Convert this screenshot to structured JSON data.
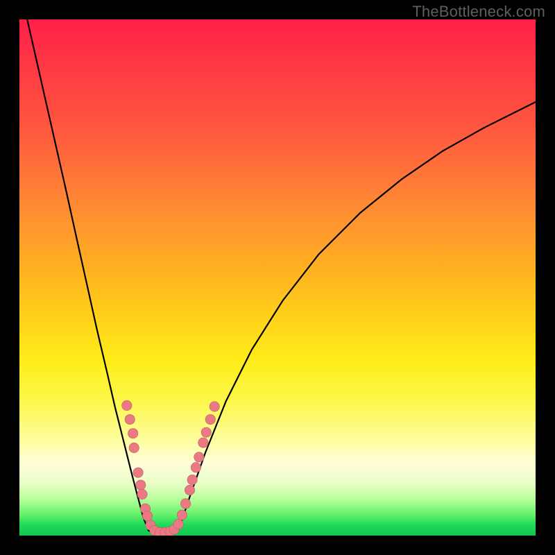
{
  "watermark": "TheBottleneck.com",
  "colors": {
    "frame": "#000000",
    "curve": "#000000",
    "bead_fill": "#e97a84",
    "bead_stroke": "#c25b66",
    "gradient_stops": [
      "#ff1f47",
      "#ff5a3e",
      "#ffb022",
      "#ffec1a",
      "#fefed8",
      "#63f06a",
      "#12c74f"
    ]
  },
  "chart_data": {
    "type": "line",
    "title": "",
    "xlabel": "",
    "ylabel": "",
    "xlim": [
      0,
      1
    ],
    "ylim": [
      0,
      1
    ],
    "note": "No tick labels visible; coordinates are normalized 0-1 with origin at bottom-left of the gradient panel.",
    "series": [
      {
        "name": "left-branch",
        "x": [
          0.015,
          0.04,
          0.065,
          0.09,
          0.11,
          0.13,
          0.15,
          0.17,
          0.185,
          0.2,
          0.215,
          0.228,
          0.24,
          0.25
        ],
        "values": [
          1.0,
          0.89,
          0.78,
          0.67,
          0.58,
          0.49,
          0.4,
          0.315,
          0.25,
          0.19,
          0.13,
          0.08,
          0.035,
          0.01
        ]
      },
      {
        "name": "valley",
        "x": [
          0.25,
          0.26,
          0.272,
          0.284,
          0.296,
          0.308
        ],
        "values": [
          0.01,
          0.004,
          0.002,
          0.002,
          0.004,
          0.01
        ]
      },
      {
        "name": "right-branch",
        "x": [
          0.308,
          0.33,
          0.36,
          0.4,
          0.45,
          0.51,
          0.58,
          0.66,
          0.74,
          0.82,
          0.9,
          0.96,
          1.0
        ],
        "values": [
          0.01,
          0.075,
          0.16,
          0.26,
          0.36,
          0.455,
          0.545,
          0.625,
          0.69,
          0.745,
          0.79,
          0.82,
          0.84
        ]
      }
    ],
    "markers": {
      "name": "beads",
      "points": [
        {
          "x": 0.208,
          "y": 0.252
        },
        {
          "x": 0.214,
          "y": 0.225
        },
        {
          "x": 0.22,
          "y": 0.198
        },
        {
          "x": 0.222,
          "y": 0.17
        },
        {
          "x": 0.23,
          "y": 0.122
        },
        {
          "x": 0.235,
          "y": 0.098
        },
        {
          "x": 0.238,
          "y": 0.08
        },
        {
          "x": 0.244,
          "y": 0.052
        },
        {
          "x": 0.248,
          "y": 0.038
        },
        {
          "x": 0.254,
          "y": 0.02
        },
        {
          "x": 0.262,
          "y": 0.01
        },
        {
          "x": 0.272,
          "y": 0.006
        },
        {
          "x": 0.282,
          "y": 0.006
        },
        {
          "x": 0.292,
          "y": 0.008
        },
        {
          "x": 0.3,
          "y": 0.012
        },
        {
          "x": 0.308,
          "y": 0.022
        },
        {
          "x": 0.315,
          "y": 0.04
        },
        {
          "x": 0.322,
          "y": 0.062
        },
        {
          "x": 0.33,
          "y": 0.088
        },
        {
          "x": 0.335,
          "y": 0.108
        },
        {
          "x": 0.342,
          "y": 0.132
        },
        {
          "x": 0.348,
          "y": 0.152
        },
        {
          "x": 0.356,
          "y": 0.18
        },
        {
          "x": 0.362,
          "y": 0.2
        },
        {
          "x": 0.37,
          "y": 0.225
        },
        {
          "x": 0.378,
          "y": 0.25
        }
      ]
    }
  }
}
